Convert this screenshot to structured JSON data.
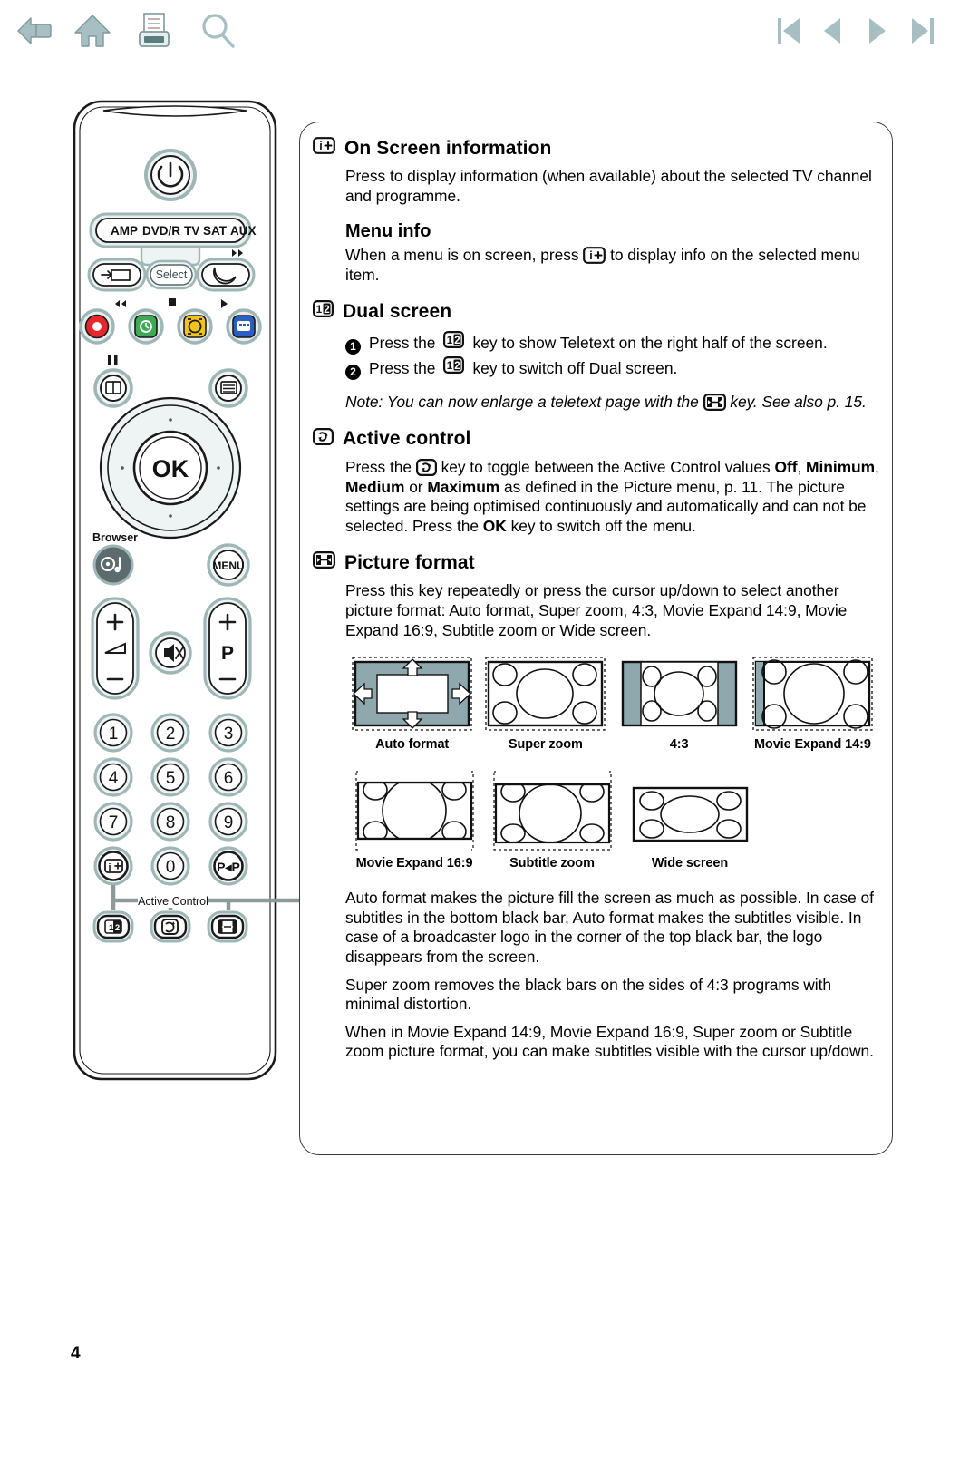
{
  "toolbar": {
    "left": [
      {
        "name": "back-icon",
        "label": "Back"
      },
      {
        "name": "home-icon",
        "label": "Home"
      },
      {
        "name": "print-icon",
        "label": "Print"
      },
      {
        "name": "search-icon",
        "label": "Search"
      }
    ],
    "right": [
      {
        "name": "first-page-icon",
        "label": "First page"
      },
      {
        "name": "previous-page-icon",
        "label": "Previous page"
      },
      {
        "name": "next-page-icon",
        "label": "Next page"
      },
      {
        "name": "last-page-icon",
        "label": "Last page"
      }
    ]
  },
  "remote": {
    "mode_buttons": [
      "AMP",
      "DVD/R",
      "TV",
      "SAT",
      "AUX"
    ],
    "select_label": "Select",
    "ok_label": "OK",
    "menu_label": "MENU",
    "browser_label": "Browser",
    "volume_label_plus": "+",
    "volume_label_minus": "–",
    "program_label": "P",
    "program_plus": "+",
    "program_minus": "–",
    "digits": [
      "1",
      "2",
      "3",
      "4",
      "5",
      "6",
      "7",
      "8",
      "9",
      "0"
    ],
    "pip_label": "P◂P",
    "info_label": "i+",
    "callout_label": "Active Control",
    "bottom_keys": [
      "dual-screen-key",
      "active-control-key",
      "picture-format-key"
    ]
  },
  "content": {
    "sections": [
      {
        "id": "on-screen-information",
        "icon": "info-plus-icon",
        "title": "On Screen information",
        "body": "Press to display information (when available) about the selected TV channel and programme."
      },
      {
        "id": "menu-info",
        "subtitle": "Menu info",
        "body_pre": "When a menu is on screen, press",
        "body_post": "to display info on the selected menu item."
      },
      {
        "id": "dual-screen",
        "icon": "dual-screen-icon",
        "title": "Dual screen",
        "steps": [
          {
            "num": "1",
            "pre": "Press the",
            "post": "key to show Teletext on the right half of the screen."
          },
          {
            "num": "2",
            "pre": "Press the",
            "post": "key to switch off Dual screen."
          }
        ],
        "note_pre": "Note: You can now enlarge a teletext page with the",
        "note_post": "key. See also p. 15."
      },
      {
        "id": "active-control",
        "icon": "active-control-icon",
        "title": "Active control",
        "line1_pre": "Press the",
        "line1_post": "key to toggle between the Active Control values",
        "values": [
          "Off",
          "Minimum",
          "Medium",
          "Maximum"
        ],
        "line2_tail": "as defined in the Picture menu, p. 11.",
        "line3": "The picture settings are being optimised continuously and automatically and can not be selected.",
        "line4_pre": "Press the",
        "line4_key": "OK",
        "line4_post": "key to switch off the menu."
      },
      {
        "id": "picture-format",
        "icon": "picture-format-icon",
        "title": "Picture format",
        "body": "Press this key repeatedly or press the cursor up/down to select another picture format: Auto format, Super zoom, 4:3, Movie Expand 14:9, Movie Expand 16:9, Subtitle zoom or Wide screen."
      }
    ],
    "formats": {
      "row1": [
        {
          "id": "auto-format",
          "caption": "Auto format"
        },
        {
          "id": "super-zoom",
          "caption": "Super zoom"
        },
        {
          "id": "four-three",
          "caption": "4:3"
        },
        {
          "id": "movie-expand-14-9",
          "caption": "Movie Expand 14:9"
        }
      ],
      "row2": [
        {
          "id": "movie-expand-16-9",
          "caption": "Movie Expand 16:9"
        },
        {
          "id": "subtitle-zoom",
          "caption": "Subtitle zoom"
        },
        {
          "id": "wide-screen",
          "caption": "Wide screen"
        }
      ]
    },
    "paragraphs": [
      "Auto format makes the picture fill the screen as much as possible. In case of subtitles in the bottom black bar, Auto format makes the subtitles visible. In case of a broadcaster logo in the corner of the top black bar, the logo disappears from the screen.",
      "Super zoom removes the black bars on the sides of 4:3 programs with minimal distortion.",
      "When in Movie Expand 14:9, Movie Expand 16:9, Super zoom or Subtitle zoom picture format, you can make subtitles visible with the cursor up/down."
    ]
  },
  "page": {
    "number": "4"
  },
  "colors": {
    "toolbar_icon": "#a7bfc2",
    "diagram_fill": "#8fa8ad",
    "remote_stroke": "#1a1a1a",
    "remote_key_ring": "#b9cbcb",
    "red_key": "#e8272d",
    "green_key": "#3faa55",
    "yellow_key": "#f0c41b",
    "blue_key": "#2b5fc4",
    "browser_key": "#5c6b6e"
  }
}
